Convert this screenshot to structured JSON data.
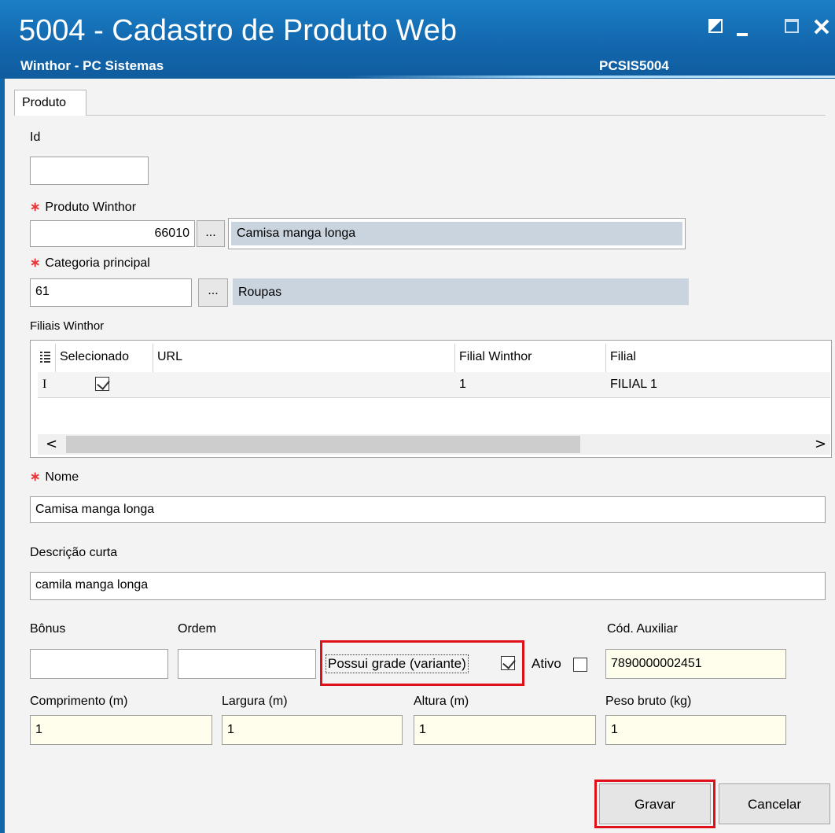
{
  "window": {
    "title": "5004 - Cadastro de Produto Web",
    "subtitle": "Winthor - PC Sistemas",
    "system_code": "PCSIS5004",
    "controls": [
      "restore-icon",
      "minimize-icon",
      "maximize-icon",
      "close-icon"
    ]
  },
  "tabs": [
    {
      "label": "Produto",
      "selected": true
    }
  ],
  "form": {
    "id": {
      "label": "Id",
      "value": ""
    },
    "produto_winthor": {
      "label": "Produto Winthor",
      "required": true,
      "code": "66010",
      "browse": "...",
      "description": "Camisa manga longa"
    },
    "categoria": {
      "label": "Categoria principal",
      "required": true,
      "code": "61",
      "browse": "...",
      "description": "Roupas"
    },
    "filiais": {
      "label": "Filiais Winthor",
      "columns": [
        "Selecionado",
        "URL",
        "Filial Winthor",
        "Filial"
      ],
      "rows": [
        {
          "selecionado": true,
          "url": "",
          "filial_winthor": "1",
          "filial": "FILIAL 1"
        }
      ],
      "scroll_left": "<",
      "scroll_right": ">"
    },
    "nome": {
      "label": "Nome",
      "required": true,
      "value": "Camisa manga longa"
    },
    "descricao_curta": {
      "label": "Descrição curta",
      "value": "camila manga longa"
    },
    "bonus": {
      "label": "Bônus",
      "value": ""
    },
    "ordem": {
      "label": "Ordem",
      "value": ""
    },
    "possui_grade": {
      "label": "Possui grade (variante)",
      "checked": true
    },
    "ativo": {
      "label": "Ativo",
      "checked": false
    },
    "cod_auxiliar": {
      "label": "Cód. Auxiliar",
      "value": "7890000002451"
    },
    "comprimento": {
      "label": "Comprimento (m)",
      "value": "1"
    },
    "largura": {
      "label": "Largura (m)",
      "value": "1"
    },
    "altura": {
      "label": "Altura (m)",
      "value": "1"
    },
    "peso_bruto": {
      "label": "Peso bruto (kg)",
      "value": "1"
    }
  },
  "buttons": {
    "save": "Gravar",
    "cancel": "Cancelar"
  },
  "colors": {
    "titlebar": "#1266ac",
    "highlight": "#e0101a",
    "readonly": "#c9d4de",
    "yellow_field": "#fffdeb"
  }
}
